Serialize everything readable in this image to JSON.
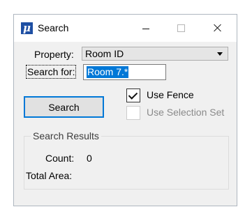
{
  "window": {
    "title": "Search",
    "icon": "microstation-mu-icon"
  },
  "form": {
    "property_label": "Property:",
    "property_value": "Room ID",
    "search_label": "Search for:",
    "search_value": "Room 7.*",
    "search_button": "Search",
    "use_fence_label": "Use Fence",
    "use_fence_checked": true,
    "use_selection_set_label": "Use Selection Set",
    "use_selection_set_checked": false,
    "use_selection_set_enabled": false
  },
  "results": {
    "group_title": "Search Results",
    "count_label": "Count:",
    "count_value": "0",
    "total_area_label": "Total Area:"
  },
  "colors": {
    "accent": "#0078d7",
    "icon_blue": "#1e4fa3",
    "background": "#f0f0f0"
  }
}
